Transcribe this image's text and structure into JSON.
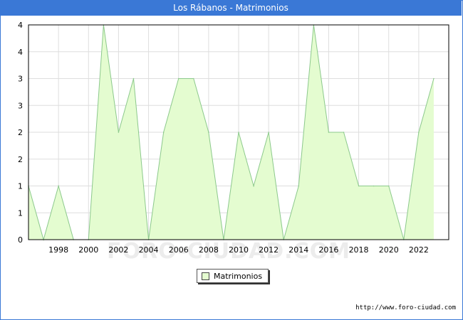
{
  "header": {
    "title": "Los Rábanos - Matrimonios"
  },
  "footer": {
    "url": "http://www.foro-ciudad.com"
  },
  "watermark": {
    "text": "FORO-CIUDAD.COM"
  },
  "colors": {
    "accent": "#3a78d6",
    "fill": "#e4fcd0",
    "line": "#8cc98c"
  },
  "chart_data": {
    "type": "area",
    "title": "Los Rábanos - Matrimonios",
    "xlabel": "",
    "ylabel": "",
    "x": [
      1996,
      1997,
      1998,
      1999,
      2000,
      2001,
      2002,
      2003,
      2004,
      2005,
      2006,
      2007,
      2008,
      2009,
      2010,
      2011,
      2012,
      2013,
      2014,
      2015,
      2016,
      2017,
      2018,
      2019,
      2020,
      2021,
      2022,
      2023
    ],
    "series": [
      {
        "name": "Matrimonios",
        "values": [
          1,
          0,
          1,
          0,
          0,
          4,
          2,
          3,
          0,
          2,
          3,
          3,
          2,
          0,
          2,
          1,
          2,
          0,
          1,
          4,
          2,
          2,
          1,
          1,
          1,
          0,
          2,
          3
        ]
      }
    ],
    "xlim": [
      1996,
      2024
    ],
    "ylim": [
      0,
      4
    ],
    "x_ticks": [
      "1998",
      "2000",
      "2002",
      "2004",
      "2006",
      "2008",
      "2010",
      "2012",
      "2014",
      "2016",
      "2018",
      "2020",
      "2022"
    ],
    "y_ticks": [
      "0",
      "1",
      "1",
      "2",
      "2",
      "3",
      "3",
      "4",
      "4"
    ],
    "grid": true,
    "legend": "bottom-center"
  }
}
